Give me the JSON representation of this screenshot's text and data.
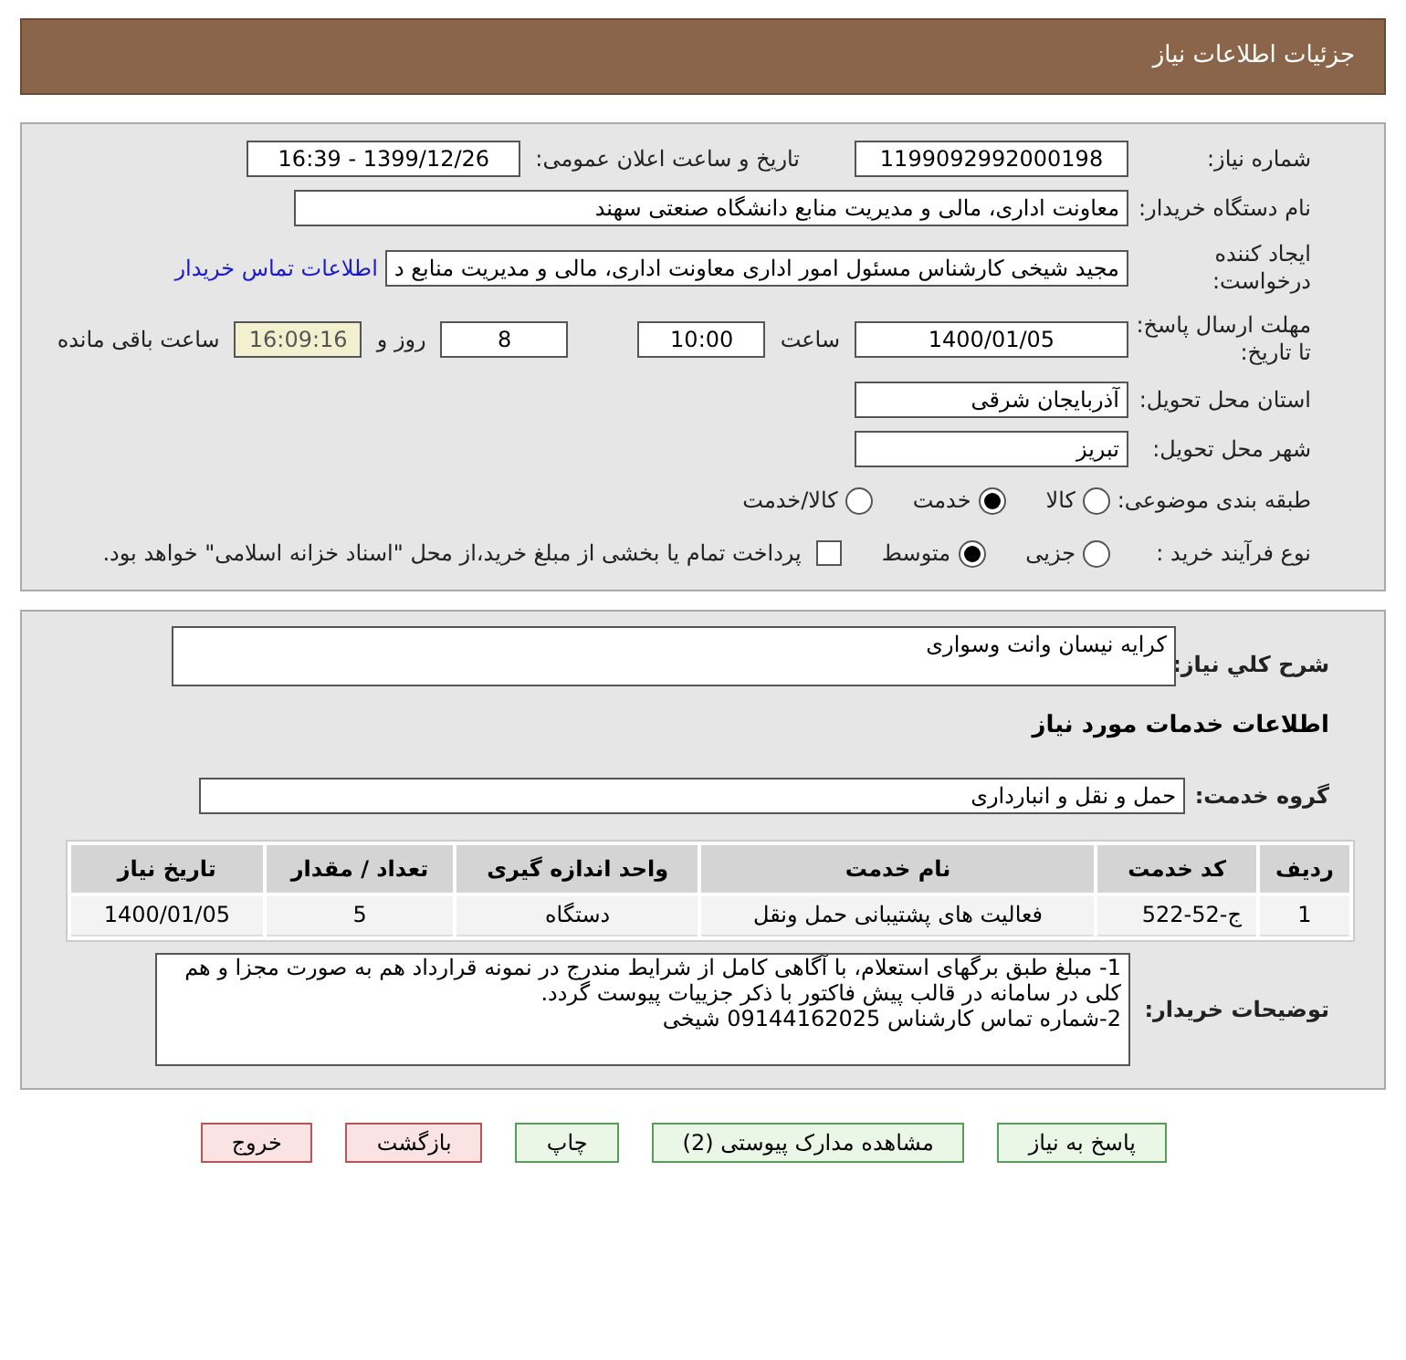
{
  "header": {
    "title": "جزئیات اطلاعات نیاز"
  },
  "info": {
    "need_number_label": "شماره نیاز:",
    "need_number": "1199092992000198",
    "announce_label": "تاریخ و ساعت اعلان عمومی:",
    "announce": "1399/12/26 - 16:39",
    "buyer_label": "نام دستگاه خریدار:",
    "buyer": "معاونت اداری، مالی و مدیریت منابع دانشگاه صنعتی سهند",
    "creator_label": "ایجاد کننده درخواست:",
    "creator": "مجید شیخی کارشناس مسئول امور اداری معاونت اداری، مالی و مدیریت منابع د",
    "contact_link": "اطلاعات تماس خریدار",
    "deadline_label": "مهلت ارسال پاسخ: تا تاریخ:",
    "deadline_date": "1400/01/05",
    "time_label": "ساعت",
    "deadline_time": "10:00",
    "days": "8",
    "days_label": "روز و",
    "remaining": "16:09:16",
    "remaining_label": "ساعت باقی مانده",
    "province_label": "استان محل تحویل:",
    "province": "آذربایجان شرقی",
    "city_label": "شهر محل تحویل:",
    "city": "تبریز",
    "category_label": "طبقه بندی موضوعی:",
    "categories": [
      {
        "label": "کالا",
        "selected": false
      },
      {
        "label": "خدمت",
        "selected": true
      },
      {
        "label": "کالا/خدمت",
        "selected": false
      }
    ],
    "process_label": "نوع فرآیند خرید :",
    "processes": [
      {
        "label": "جزیی",
        "selected": false
      },
      {
        "label": "متوسط",
        "selected": true
      }
    ],
    "payment": {
      "label": "پرداخت تمام یا بخشی از مبلغ خرید،از محل \"اسناد خزانه اسلامی\" خواهد بود.",
      "checked": false
    }
  },
  "details": {
    "summary_label": "شرح کلي نياز:",
    "summary": "کرایه نیسان وانت وسواری",
    "services_heading": "اطلاعات خدمات مورد نیاز",
    "group_label": "گروه خدمت:",
    "group": "حمل و نقل و انبارداری",
    "table": {
      "columns": [
        "ردیف",
        "کد خدمت",
        "نام خدمت",
        "واحد اندازه گیری",
        "تعداد / مقدار",
        "تاریخ نیاز"
      ],
      "rows": [
        [
          "1",
          "ج-52-522",
          "فعالیت های پشتیبانی حمل ونقل",
          "دستگاه",
          "5",
          "1400/01/05"
        ]
      ]
    },
    "notes_label": "توضیحات خریدار:",
    "notes": [
      "1- مبلغ طبق برگهای استعلام، با آگاهی کامل از شرایط مندرج در نمونه قرارداد هم به صورت مجزا و هم کلی در سامانه در قالب پیش فاکتور با ذکر جزییات پیوست گردد.",
      "2-شماره تماس کارشناس 09144162025 شیخی"
    ]
  },
  "buttons": [
    {
      "label": "پاسخ به نیاز",
      "kind": "green"
    },
    {
      "label": "مشاهده مدارک پیوستی (2)",
      "kind": "green"
    },
    {
      "label": "چاپ",
      "kind": "green"
    },
    {
      "label": "بازگشت",
      "kind": "red"
    },
    {
      "label": "خروج",
      "kind": "red"
    }
  ]
}
